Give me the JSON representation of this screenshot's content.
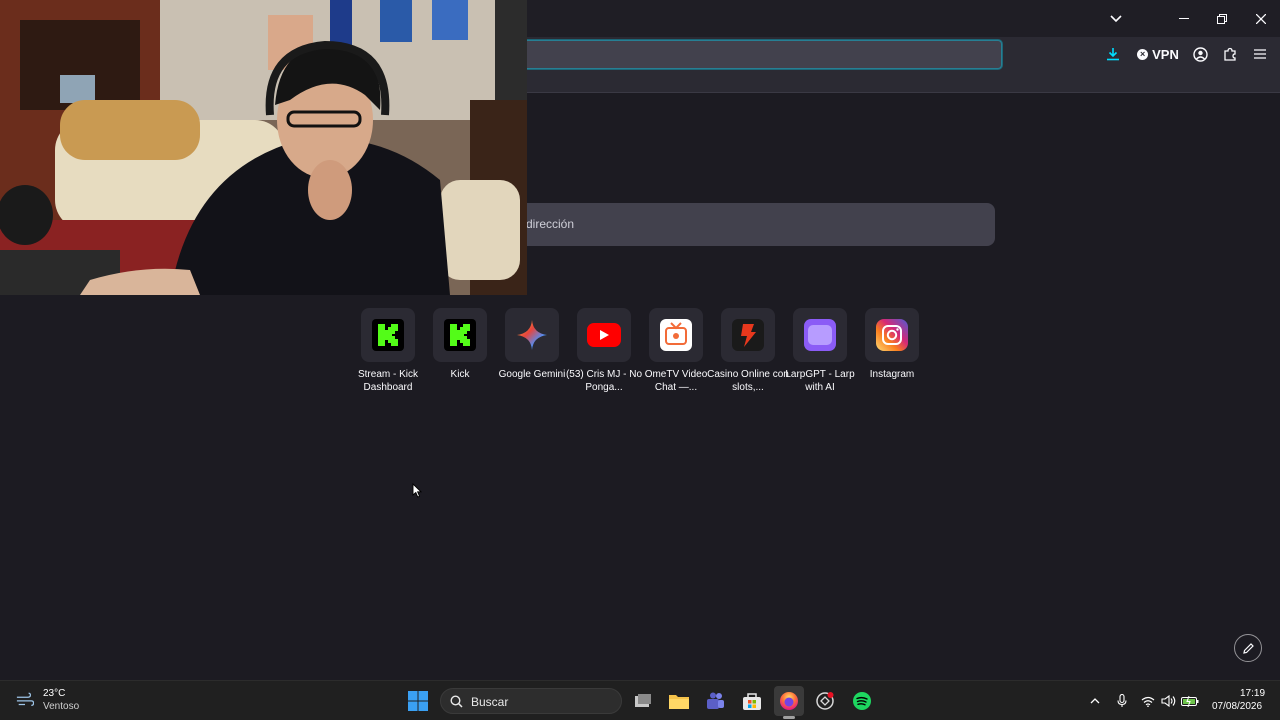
{
  "browser": {
    "vpn_label": "VPN",
    "search_placeholder": "dirección"
  },
  "shortcuts": [
    {
      "label": "Stream - Kick Dashboard",
      "icon": "kick-icon",
      "color": "#53fc18"
    },
    {
      "label": "Kick",
      "icon": "kick-icon",
      "color": "#53fc18"
    },
    {
      "label": "Google Gemini",
      "icon": "gemini-icon",
      "color": "#4f8ef7"
    },
    {
      "label": "(53) Cris MJ - No Ponga...",
      "icon": "youtube-icon",
      "color": "#ff0000"
    },
    {
      "label": "OmeTV Video Chat —...",
      "icon": "ometv-icon",
      "color": "#f26b38"
    },
    {
      "label": "Casino Online con slots,...",
      "icon": "casino-icon",
      "color": "#e8381d"
    },
    {
      "label": "LarpGPT - Larp with AI",
      "icon": "larpgpt-icon",
      "color": "#8b5cf6"
    },
    {
      "label": "Instagram",
      "icon": "instagram-icon",
      "color": "#dd2a7b"
    }
  ],
  "taskbar": {
    "weather_temp": "23°C",
    "weather_desc": "Ventoso",
    "search_label": "Buscar",
    "time": "17:19",
    "date": "07/08/2026"
  }
}
